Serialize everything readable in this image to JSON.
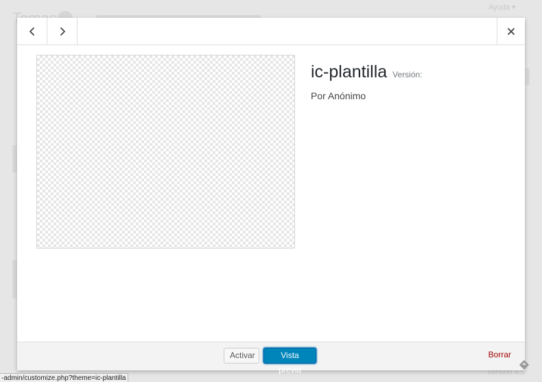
{
  "background": {
    "page_title": "Temas",
    "help_label": "Ayuda ▾",
    "version_text": "Versión 4.5"
  },
  "modal": {
    "nav": {
      "prev_icon": "chevron-left-icon",
      "next_icon": "chevron-right-icon",
      "close_icon": "close-icon"
    },
    "theme": {
      "name": "ic-plantilla",
      "version_label": "Versión:",
      "author": "Por Anónimo"
    },
    "footer": {
      "activate_label": "Activar",
      "preview_label": "Vista previa",
      "delete_label": "Borrar"
    }
  },
  "status_bar": {
    "url": "-admin/customize.php?theme=ic-plantilla"
  },
  "colors": {
    "primary_button": "#0085ba",
    "delete_link": "#a00000",
    "modal_bg": "#ffffff",
    "footer_bg": "#f3f3f3"
  }
}
